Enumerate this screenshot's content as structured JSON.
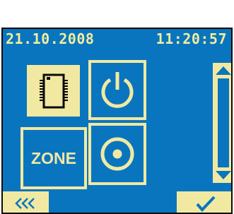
{
  "status_bar": {
    "date": "21.10.2008",
    "time": "11:20:57"
  },
  "tiles": {
    "zone_label": "ZONE"
  },
  "colors": {
    "screen_background": "#0a75bf",
    "foreground": "#f1e9a2",
    "status_text": "#f3ed9c",
    "frame": "#0a0a0a"
  },
  "icons": {
    "tile_1": "microchip-icon",
    "tile_2": "power-icon",
    "tile_3": "zone-button",
    "tile_4": "target-icon",
    "scroll_up": "arrow-up-icon",
    "scroll_down": "arrow-down-icon",
    "back": "triple-chevron-left-icon",
    "confirm": "checkmark-icon"
  }
}
